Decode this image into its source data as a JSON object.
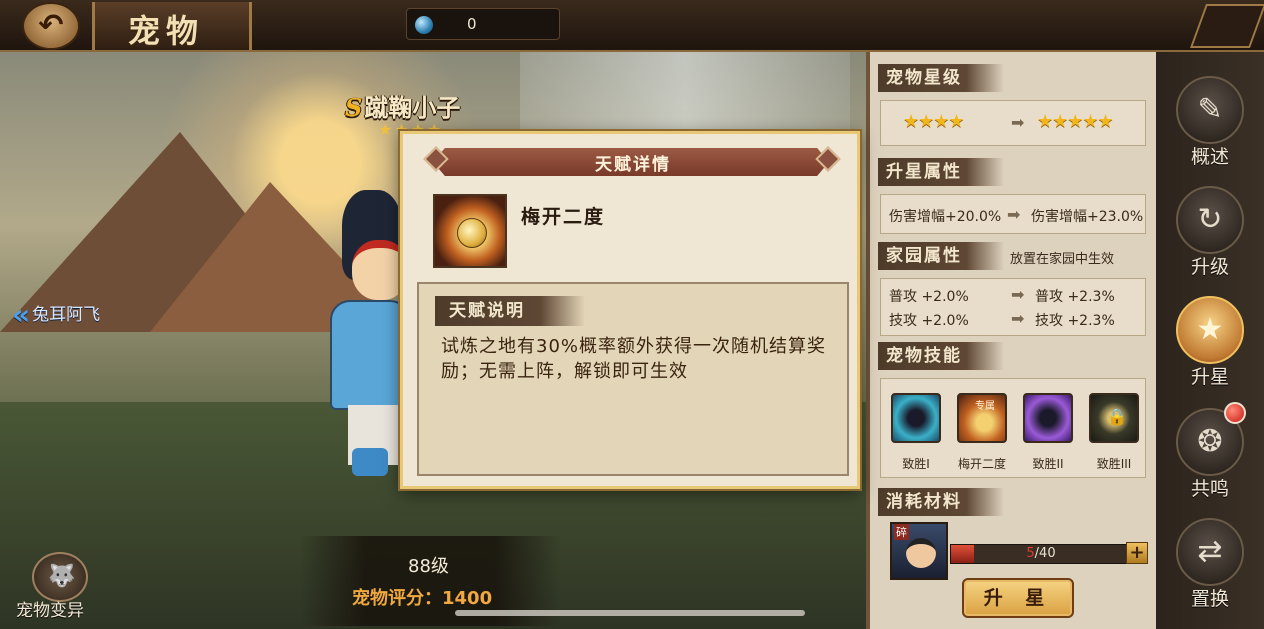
{
  "header": {
    "title": "宠物",
    "currency_value": "0",
    "back_icon": "back-arrow-icon"
  },
  "pet": {
    "grade": "S",
    "name": "蹴鞠小子",
    "level": "88级",
    "score_label": "宠物评分：",
    "score_value": "1400",
    "prev_pet": "兔耳阿飞",
    "mutate_label": "宠物变异"
  },
  "panel": {
    "star_level": {
      "heading": "宠物星级",
      "from_stars": "★★★★",
      "to_stars": "★★★★★"
    },
    "upgrade_attrs": {
      "heading": "升星属性",
      "from": "伤害增幅+20.0%",
      "to": "伤害增幅+23.0%"
    },
    "home_attrs": {
      "heading": "家园属性",
      "note": "放置在家园中生效",
      "rows": [
        {
          "from": "普攻 +2.0%",
          "to": "普攻 +2.3%"
        },
        {
          "from": "技攻 +2.0%",
          "to": "技攻 +2.3%"
        }
      ]
    },
    "skills": {
      "heading": "宠物技能",
      "items": [
        {
          "label": "致胜I",
          "tag": ""
        },
        {
          "label": "梅开二度",
          "tag": "专属"
        },
        {
          "label": "致胜II",
          "tag": ""
        },
        {
          "label": "致胜III",
          "tag": ""
        }
      ]
    },
    "materials": {
      "heading": "消耗材料",
      "tag": "碎",
      "current": "5",
      "total": "/40",
      "progress": 0.125,
      "plus": "+",
      "button": "升 星"
    }
  },
  "nav": [
    {
      "label": "概述",
      "icon": "book-icon"
    },
    {
      "label": "升级",
      "icon": "level-up-icon"
    },
    {
      "label": "升星",
      "icon": "star-up-icon",
      "active": true
    },
    {
      "label": "共鸣",
      "icon": "resonance-icon",
      "badge": true
    },
    {
      "label": "置换",
      "icon": "swap-icon"
    }
  ],
  "modal": {
    "title": "天赋详情",
    "skill_name": "梅开二度",
    "desc_heading": "天赋说明",
    "desc_text": "试炼之地有30%概率额外获得一次随机结算奖励；无需上阵，解锁即可生效"
  },
  "colors": {
    "accent_gold": "#f2b61c",
    "score_orange": "#f0a840",
    "panel_bg": "#ddd2bd",
    "modal_title": "#7a3a2a"
  }
}
